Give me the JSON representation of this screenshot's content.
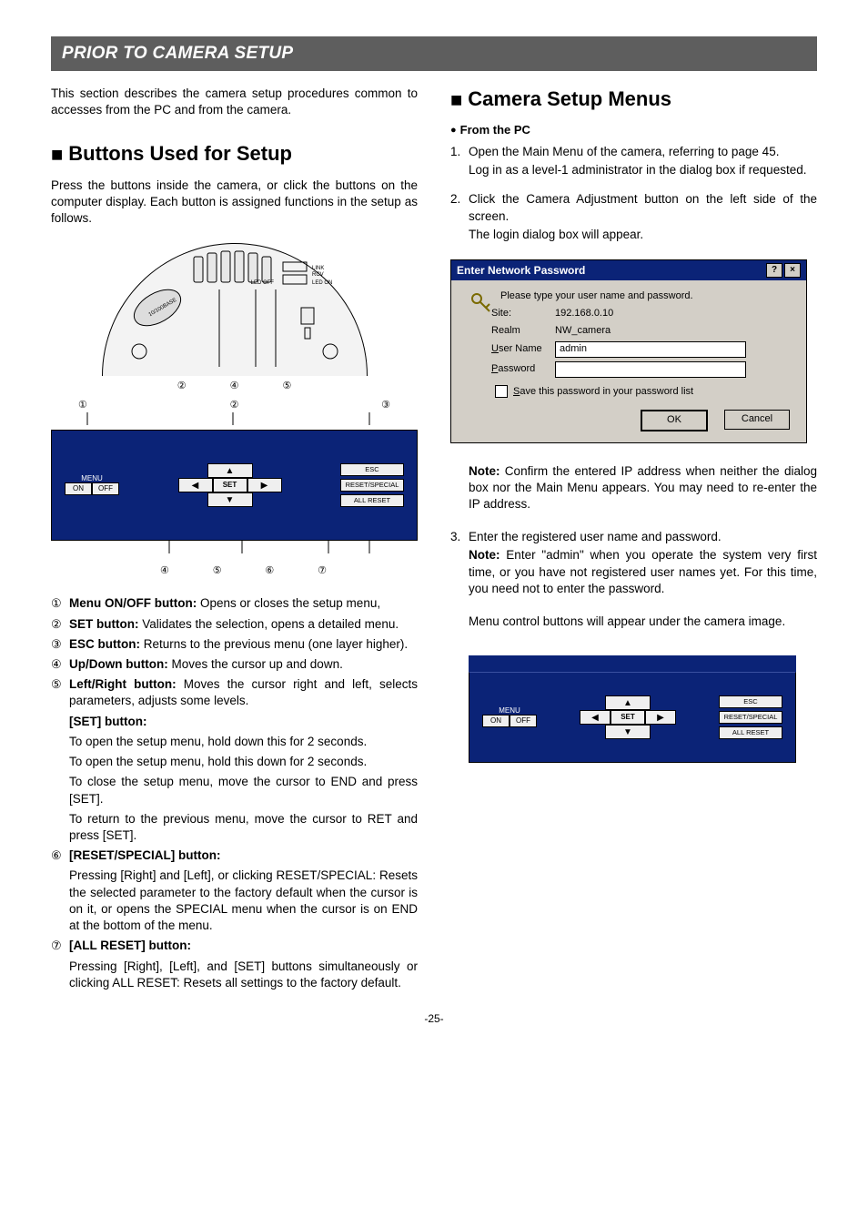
{
  "banner": "PRIOR TO CAMERA SETUP",
  "intro": "This section describes the camera setup procedures common to accesses from the PC and from the camera.",
  "buttons_section": {
    "heading": "Buttons Used for Setup",
    "lead": "Press the buttons inside the camera, or click the buttons on the computer display. Each button is assigned functions in the setup as follows.",
    "arc_refs": [
      "②",
      "④",
      "⑤"
    ],
    "panel_refs_top": [
      "①",
      "②",
      "③"
    ],
    "panel_refs_bottom": [
      "④",
      "⑤",
      "⑥",
      "⑦"
    ],
    "panel": {
      "menu_label": "MENU",
      "on": "ON",
      "off": "OFF",
      "up": "▲",
      "down": "▼",
      "left": "◀",
      "right": "▶",
      "set": "SET",
      "esc": "ESC",
      "reset": "RESET/SPECIAL",
      "all_reset": "ALL RESET"
    },
    "items": [
      {
        "n": "①",
        "label": "Menu ON/OFF button:",
        "text": " Opens or closes the setup menu,"
      },
      {
        "n": "②",
        "label": "SET button:",
        "text": " Validates the selection, opens a detailed menu."
      },
      {
        "n": "③",
        "label": "ESC button:",
        "text": " Returns to the previous menu (one layer higher)."
      },
      {
        "n": "④",
        "label": "Up/Down button:",
        "text": " Moves the cursor up and down."
      },
      {
        "n": "⑤",
        "label": "Left/Right button:",
        "text": " Moves the cursor right and left, selects parameters, adjusts some levels."
      }
    ],
    "set_block": {
      "label": "[SET] button:",
      "lines": [
        "To open the setup menu, hold down this for 2 seconds.",
        "To open the setup menu, hold this down for 2 seconds.",
        "To close the setup menu, move the cursor to END and press [SET].",
        "To return to the previous menu, move the cursor to RET and press [SET]."
      ]
    },
    "reset_block": {
      "n": "⑥",
      "label": "[RESET/SPECIAL] button:",
      "text": "Pressing [Right] and [Left], or clicking RESET/SPECIAL: Resets the selected parameter to the factory default when the cursor is on it, or opens the SPECIAL menu when the cursor is on END at the bottom of the menu."
    },
    "allreset_block": {
      "n": "⑦",
      "label": "[ALL RESET] button:",
      "text": "Pressing [Right], [Left], and [SET] buttons simultaneously or clicking ALL RESET: Resets all settings to the factory default."
    }
  },
  "menus_section": {
    "heading": "Camera Setup Menus",
    "from_pc": "From the PC",
    "step1a": "Open the Main Menu of the camera, referring to page 45.",
    "step1b": "Log in as a level-1 administrator in the dialog box if requested.",
    "step2a": "Click the Camera Adjustment button on the left side of the screen.",
    "step2b": "The login dialog box will appear.",
    "dialog": {
      "title": "Enter Network Password",
      "prompt": "Please type your user name and password.",
      "site_lbl": "Site:",
      "site_val": "192.168.0.10",
      "realm_lbl": "Realm",
      "realm_val": "NW_camera",
      "user_lbl": "User Name",
      "user_val": "admin",
      "pass_lbl": "Password",
      "save_lbl": "Save this password in your password list",
      "ok": "OK",
      "cancel": "Cancel"
    },
    "note1_lbl": "Note:",
    "note1": " Confirm the entered IP address when neither the dialog box nor the Main Menu appears. You may need to re-enter the IP address.",
    "step3a": "Enter the registered user name and password.",
    "note2_lbl": "Note:",
    "note2": " Enter \"admin\" when you operate the system very first time, or you have not registered user names yet. For this time, you need not to enter the password.",
    "closing": "Menu control buttons will appear under the camera image."
  },
  "page_number": "-25-"
}
